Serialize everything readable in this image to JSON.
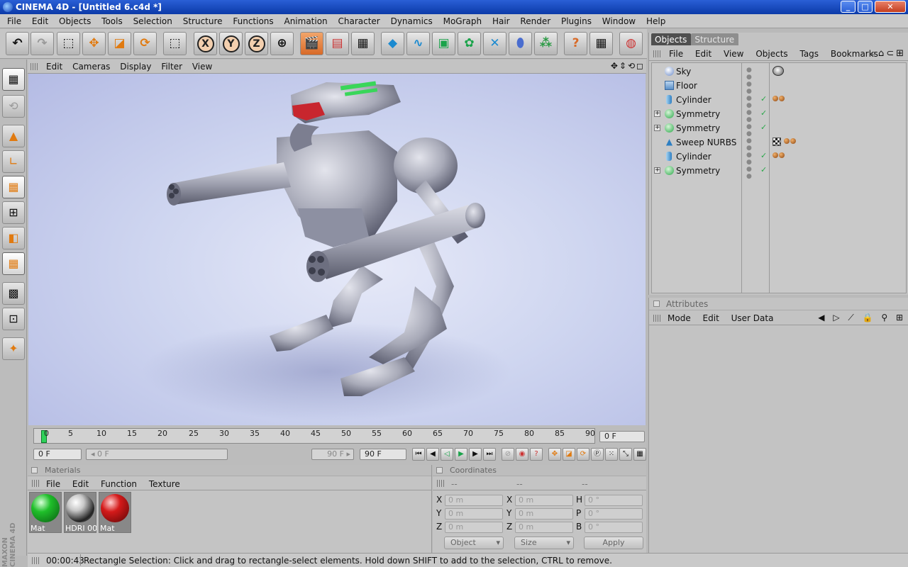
{
  "window": {
    "title": "CINEMA 4D - [Untitled 6.c4d *]",
    "controls": [
      "_",
      "□",
      "✕"
    ]
  },
  "menubar": [
    "File",
    "Edit",
    "Objects",
    "Tools",
    "Selection",
    "Structure",
    "Functions",
    "Animation",
    "Character",
    "Dynamics",
    "MoGraph",
    "Hair",
    "Render",
    "Plugins",
    "Window",
    "Help"
  ],
  "toolbar": {
    "axis_x": "X",
    "axis_y": "Y",
    "axis_z": "Z"
  },
  "viewport": {
    "menu": [
      "Edit",
      "Cameras",
      "Display",
      "Filter",
      "View"
    ],
    "nav_icons": "✥⇕⟲◻"
  },
  "timeline": {
    "ticks": [
      "0",
      "5",
      "10",
      "15",
      "20",
      "25",
      "30",
      "35",
      "40",
      "45",
      "50",
      "55",
      "60",
      "65",
      "70",
      "75",
      "80",
      "85",
      "90"
    ],
    "current_frame": "0 F",
    "start_frame": "0 F",
    "range_start": "◂ 0 F",
    "range_end": "90 F ▸",
    "end_frame": "90 F"
  },
  "materials": {
    "title": "Materials",
    "menu": [
      "File",
      "Edit",
      "Function",
      "Texture"
    ],
    "items": [
      {
        "label": "Mat",
        "color": "#1fbf2a"
      },
      {
        "label": "HDRI 00",
        "color": "#c8c8c8"
      },
      {
        "label": "Mat",
        "color": "#d41a1a"
      }
    ]
  },
  "coordinates": {
    "title": "Coordinates",
    "col_headers": [
      "--",
      "--",
      "--"
    ],
    "rows": [
      {
        "l1": "X",
        "v1": "0 m",
        "l2": "X",
        "v2": "0 m",
        "l3": "H",
        "v3": "0 °"
      },
      {
        "l1": "Y",
        "v1": "0 m",
        "l2": "Y",
        "v2": "0 m",
        "l3": "P",
        "v3": "0 °"
      },
      {
        "l1": "Z",
        "v1": "0 m",
        "l2": "Z",
        "v2": "0 m",
        "l3": "B",
        "v3": "0 °"
      }
    ],
    "mode_select": "Object",
    "size_select": "Size",
    "apply_label": "Apply"
  },
  "status": {
    "time": "00:00:43",
    "message": "Rectangle Selection: Click and drag to rectangle-select elements. Hold down SHIFT to add to the selection, CTRL to remove."
  },
  "object_manager": {
    "tabs": [
      "Objects",
      "Structure"
    ],
    "menu": [
      "File",
      "Edit",
      "View",
      "Objects",
      "Tags",
      "Bookmarks"
    ],
    "icons": "⌕⌂⊂⊞",
    "objects": [
      {
        "name": "Sky",
        "icon": "sky-icon",
        "expandable": false,
        "check": "",
        "tags": "sky"
      },
      {
        "name": "Floor",
        "icon": "floor-icon",
        "expandable": false,
        "check": "",
        "tags": ""
      },
      {
        "name": "Cylinder",
        "icon": "cylinder-icon",
        "expandable": false,
        "check": "✓",
        "tags": "material"
      },
      {
        "name": "Symmetry",
        "icon": "symmetry-icon",
        "expandable": true,
        "check": "✓",
        "tags": ""
      },
      {
        "name": "Symmetry",
        "icon": "symmetry-icon",
        "expandable": true,
        "check": "✓",
        "tags": ""
      },
      {
        "name": "Sweep NURBS",
        "icon": "sweep-nurbs-icon",
        "expandable": false,
        "check": "",
        "tags": "checker"
      },
      {
        "name": "Cylinder",
        "icon": "cylinder-icon",
        "expandable": false,
        "check": "✓",
        "tags": "material"
      },
      {
        "name": "Symmetry",
        "icon": "symmetry-icon",
        "expandable": true,
        "check": "✓",
        "tags": ""
      }
    ]
  },
  "attributes": {
    "title": "Attributes",
    "menu": [
      "Mode",
      "Edit",
      "User Data"
    ],
    "icons": "◀ ▷ ⟋ 🔒 ⚲ ⊞"
  },
  "branding": {
    "logo": "MAXON CINEMA 4D"
  }
}
